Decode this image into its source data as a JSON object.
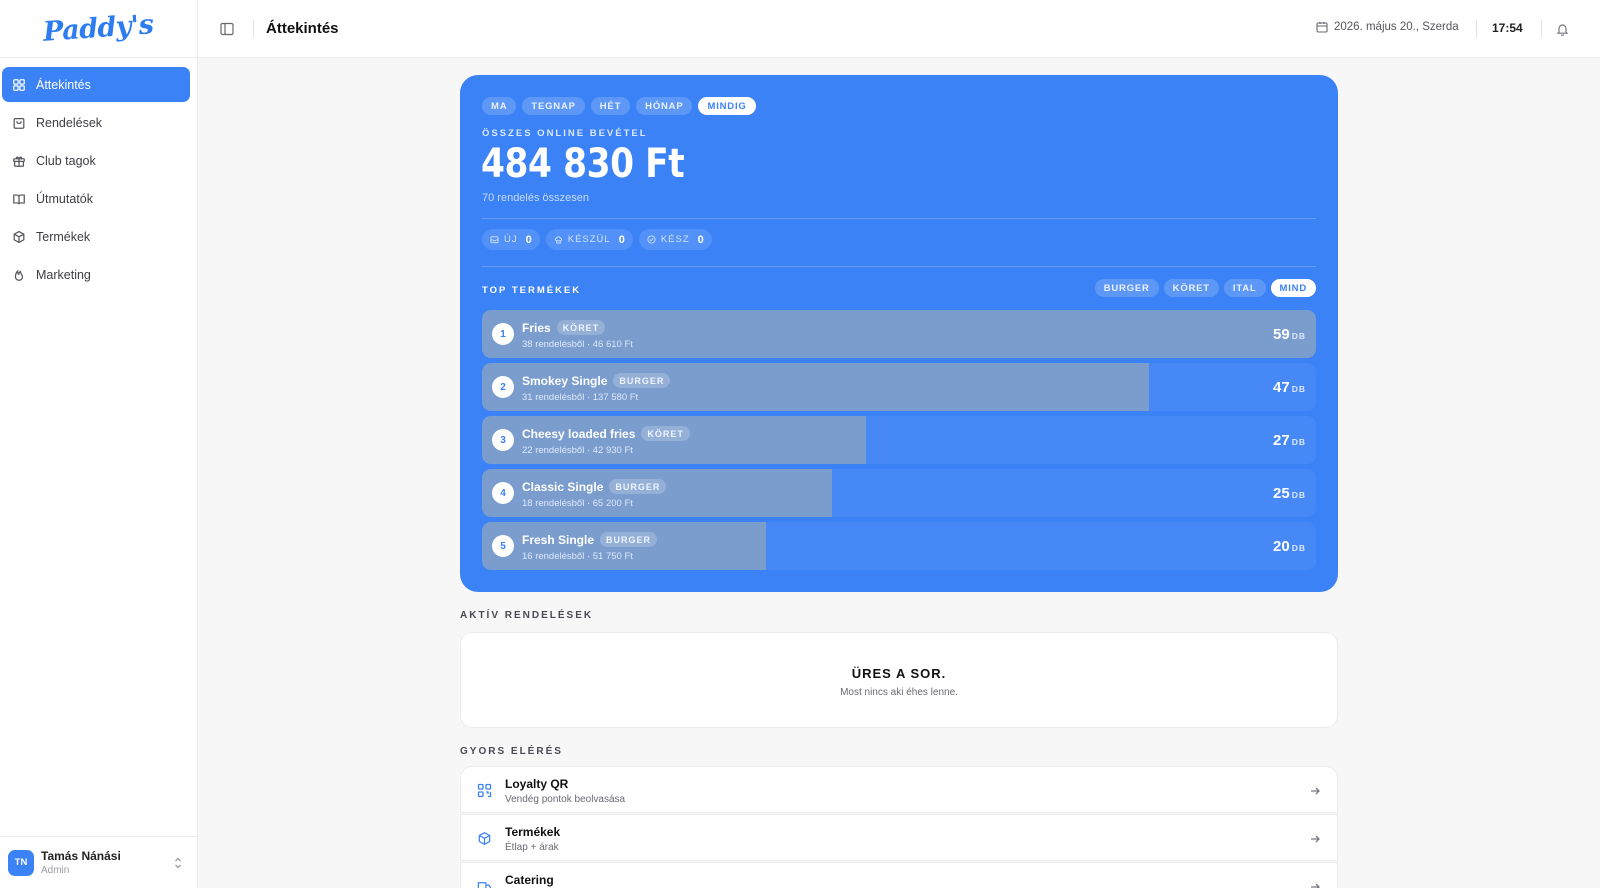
{
  "app": {
    "logo_text": "Paddy's",
    "brand_color": "#3b82f6"
  },
  "sidebar": {
    "items": [
      {
        "label": "Áttekintés",
        "icon": "grid-icon",
        "active": true
      },
      {
        "label": "Rendelések",
        "icon": "bag-icon"
      },
      {
        "label": "Club tagok",
        "icon": "gift-icon"
      },
      {
        "label": "Útmutatók",
        "icon": "book-icon"
      },
      {
        "label": "Termékek",
        "icon": "box-icon"
      },
      {
        "label": "Marketing",
        "icon": "flame-icon"
      }
    ],
    "user": {
      "initials": "TN",
      "name": "Tamás Nánási",
      "role": "Admin"
    }
  },
  "topbar": {
    "title": "Áttekintés",
    "date": "2026. május 20., Szerda",
    "time": "17:54"
  },
  "hero": {
    "periods": [
      "MA",
      "TEGNAP",
      "HÉT",
      "HÓNAP",
      "MINDIG"
    ],
    "active_period": "MINDIG",
    "revenue_label": "ÖSSZES ONLINE BEVÉTEL",
    "revenue_amount": "484 830 Ft",
    "revenue_sub": "70 rendelés összesen",
    "statuses": [
      {
        "label": "ÚJ",
        "count": "0",
        "icon": "inbox-icon"
      },
      {
        "label": "KÉSZÜL",
        "count": "0",
        "icon": "chef-icon"
      },
      {
        "label": "KÉSZ",
        "count": "0",
        "icon": "check-circle-icon"
      }
    ],
    "top_label": "TOP TERMÉKEK",
    "categories": [
      "BURGER",
      "KÖRET",
      "ITAL",
      "MIND"
    ],
    "active_category": "MIND",
    "unit": "DB",
    "products": [
      {
        "rank": "1",
        "name": "Fries",
        "tag": "KÖRET",
        "meta": "38 rendelésből · 46 610 Ft",
        "qty": "59",
        "share": 1.0
      },
      {
        "rank": "2",
        "name": "Smokey Single",
        "tag": "BURGER",
        "meta": "31 rendelésből · 137 580 Ft",
        "qty": "47",
        "share": 0.8
      },
      {
        "rank": "3",
        "name": "Cheesy loaded fries",
        "tag": "KÖRET",
        "meta": "22 rendelésből · 42 930 Ft",
        "qty": "27",
        "share": 0.46
      },
      {
        "rank": "4",
        "name": "Classic Single",
        "tag": "BURGER",
        "meta": "18 rendelésből · 65 200 Ft",
        "qty": "25",
        "share": 0.42
      },
      {
        "rank": "5",
        "name": "Fresh Single",
        "tag": "BURGER",
        "meta": "16 rendelésből · 51 750 Ft",
        "qty": "20",
        "share": 0.34
      }
    ]
  },
  "active_orders": {
    "label": "AKTÍV RENDELÉSEK",
    "empty_title": "ÜRES A SOR.",
    "empty_sub": "Most nincs aki éhes lenne."
  },
  "quick_access": {
    "label": "GYORS ELÉRÉS",
    "items": [
      {
        "title": "Loyalty QR",
        "sub": "Vendég pontok beolvasása",
        "icon": "qr-icon"
      },
      {
        "title": "Termékek",
        "sub": "Étlap + árak",
        "icon": "box-icon"
      },
      {
        "title": "Catering",
        "sub": "",
        "icon": "truck-icon"
      }
    ]
  }
}
